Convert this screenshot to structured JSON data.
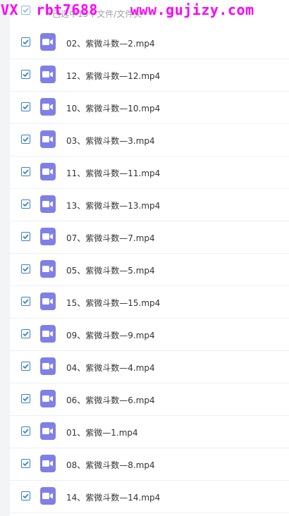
{
  "watermark": {
    "left": "VX  rbt7688",
    "right": "www.gujizy.com"
  },
  "header": {
    "selection_label": "已选中15个文件/文件夹"
  },
  "files": [
    {
      "name": "02、紫微斗数—2.mp4",
      "checked": true
    },
    {
      "name": "12、紫微斗数—12.mp4",
      "checked": true
    },
    {
      "name": "10、紫微斗数—10.mp4",
      "checked": true
    },
    {
      "name": "03、紫微斗数—3.mp4",
      "checked": true
    },
    {
      "name": "11、紫微斗数—11.mp4",
      "checked": true
    },
    {
      "name": "13、紫微斗数—13.mp4",
      "checked": true
    },
    {
      "name": "07、紫微斗数—7.mp4",
      "checked": true
    },
    {
      "name": "05、紫微斗数—5.mp4",
      "checked": true
    },
    {
      "name": "15、紫微斗数—15.mp4",
      "checked": true
    },
    {
      "name": "09、紫微斗数—9.mp4",
      "checked": true
    },
    {
      "name": "04、紫微斗数—4.mp4",
      "checked": true
    },
    {
      "name": "06、紫微斗数—6.mp4",
      "checked": true
    },
    {
      "name": "01、紫微—1.mp4",
      "checked": true
    },
    {
      "name": "08、紫微斗数—8.mp4",
      "checked": true
    },
    {
      "name": "14、紫微斗数—14.mp4",
      "checked": true
    }
  ],
  "colors": {
    "checkbox": "#3b82c4",
    "video_icon": "#7f7fe8",
    "watermark": "#ff00ff"
  },
  "icons": {
    "checkbox": "check-icon",
    "file": "video-file-icon"
  }
}
